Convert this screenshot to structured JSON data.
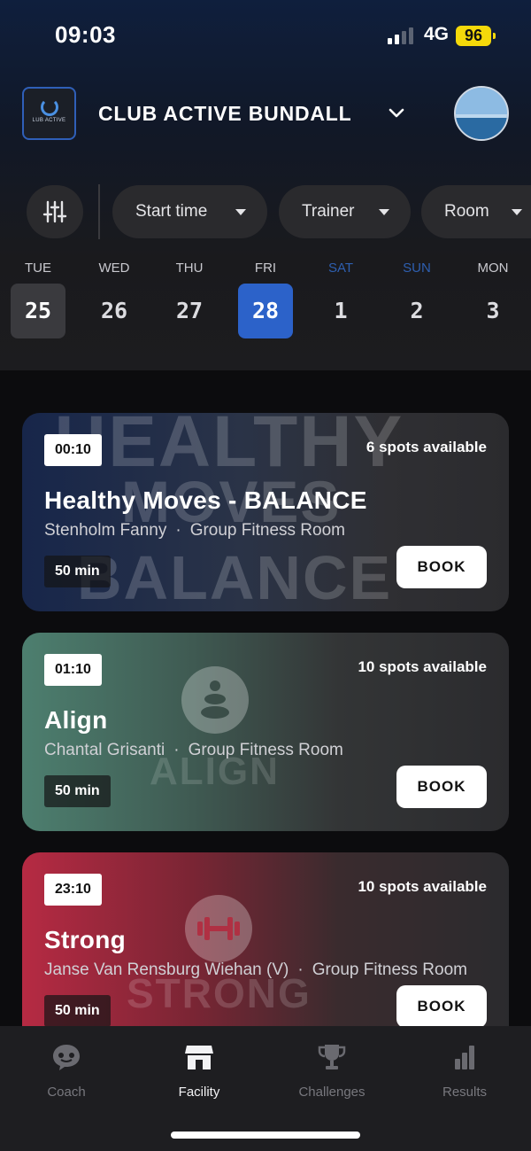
{
  "status_bar": {
    "time": "09:03",
    "network": "4G",
    "battery": "96"
  },
  "header": {
    "club_name": "CLUB ACTIVE BUNDALL",
    "logo_text": "LUB ACTIVE"
  },
  "filters": [
    {
      "label": "Start time"
    },
    {
      "label": "Trainer"
    },
    {
      "label": "Room"
    }
  ],
  "days": [
    {
      "dow": "TUE",
      "num": "25",
      "state": "today",
      "weekend": false
    },
    {
      "dow": "WED",
      "num": "26",
      "state": "",
      "weekend": false
    },
    {
      "dow": "THU",
      "num": "27",
      "state": "",
      "weekend": false
    },
    {
      "dow": "FRI",
      "num": "28",
      "state": "selected",
      "weekend": false
    },
    {
      "dow": "SAT",
      "num": "1",
      "state": "",
      "weekend": true
    },
    {
      "dow": "SUN",
      "num": "2",
      "state": "",
      "weekend": true
    },
    {
      "dow": "MON",
      "num": "3",
      "state": "",
      "weekend": false
    }
  ],
  "classes": [
    {
      "time": "00:10",
      "spots": "6 spots available",
      "title": "Healthy Moves - BALANCE",
      "trainer": "Stenholm Fanny",
      "room": "Group Fitness Room",
      "duration": "50 min",
      "book_label": "BOOK",
      "bg_word_top": "HEALTHY",
      "bg_word_mid": "MOVES",
      "bg_word_bottom": "BALANCE"
    },
    {
      "time": "01:10",
      "spots": "10 spots available",
      "title": "Align",
      "trainer": "Chantal Grisanti",
      "room": "Group Fitness Room",
      "duration": "50 min",
      "book_label": "BOOK",
      "bg_word": "ALIGN"
    },
    {
      "time": "23:10",
      "spots": "10 spots available",
      "title": "Strong",
      "trainer": "Janse Van Rensburg Wiehan (V)",
      "room": "Group Fitness Room",
      "duration": "50 min",
      "book_label": "BOOK",
      "bg_word": "STRONG"
    }
  ],
  "tabs": [
    {
      "label": "Coach",
      "icon": "chat-bubble-icon",
      "active": false
    },
    {
      "label": "Facility",
      "icon": "storefront-icon",
      "active": true
    },
    {
      "label": "Challenges",
      "icon": "trophy-icon",
      "active": false
    },
    {
      "label": "Results",
      "icon": "bar-chart-icon",
      "active": false
    }
  ],
  "colors": {
    "accent": "#2c62c9",
    "weekend": "#2e5fb0",
    "battery": "#f5d90a",
    "card_balance": "#17264a",
    "card_align": "#4d7f6f",
    "card_strong": "#b62a43"
  }
}
